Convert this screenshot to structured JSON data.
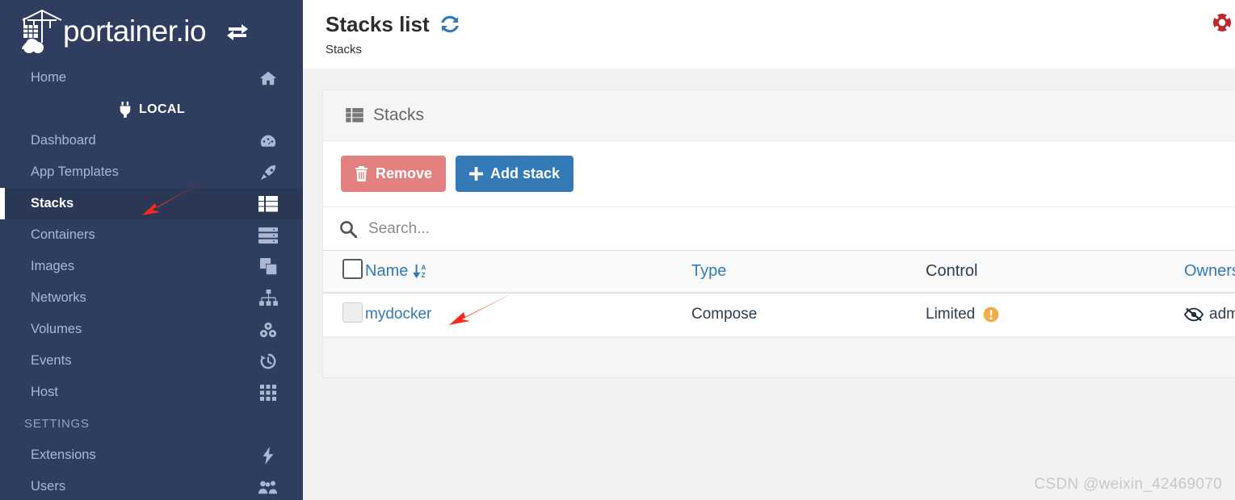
{
  "brand": {
    "name": "portainer.io",
    "logo_icon": "crane-container-cloud-icon",
    "swap_icon": "exchange-arrows-icon"
  },
  "sidebar": {
    "endpoint": {
      "label": "LOCAL",
      "icon": "plug-icon"
    },
    "items": [
      {
        "label": "Home",
        "icon": "home-icon",
        "active": false
      },
      {
        "label": "Dashboard",
        "icon": "tachometer-icon",
        "active": false
      },
      {
        "label": "App Templates",
        "icon": "rocket-icon",
        "active": false
      },
      {
        "label": "Stacks",
        "icon": "list-table-icon",
        "active": true
      },
      {
        "label": "Containers",
        "icon": "server-icon",
        "active": false
      },
      {
        "label": "Images",
        "icon": "clone-icon",
        "active": false
      },
      {
        "label": "Networks",
        "icon": "sitemap-icon",
        "active": false
      },
      {
        "label": "Volumes",
        "icon": "cubes-icon",
        "active": false
      },
      {
        "label": "Events",
        "icon": "history-icon",
        "active": false
      },
      {
        "label": "Host",
        "icon": "grid-icon",
        "active": false
      }
    ],
    "settings_section": {
      "label": "SETTINGS"
    },
    "settings_items": [
      {
        "label": "Extensions",
        "icon": "bolt-icon",
        "active": false
      },
      {
        "label": "Users",
        "icon": "users-icon",
        "active": false
      }
    ]
  },
  "header": {
    "title": "Stacks list",
    "refresh_icon": "refresh-sync-icon",
    "breadcrumb": "Stacks",
    "support_icon": "life-ring-icon"
  },
  "panel": {
    "title": "Stacks",
    "title_icon": "list-table-icon",
    "buttons": {
      "remove": {
        "label": "Remove",
        "icon": "trash-icon",
        "color": "#e38080"
      },
      "add": {
        "label": "Add stack",
        "icon": "plus-icon",
        "color": "#337ab7"
      }
    },
    "search": {
      "placeholder": "Search...",
      "value": "",
      "icon": "search-icon"
    },
    "table": {
      "columns": [
        {
          "key": "name",
          "label": "Name",
          "sortable": true,
          "sort_icon": "sort-alpha-down-icon"
        },
        {
          "key": "type",
          "label": "Type",
          "sortable": true
        },
        {
          "key": "control",
          "label": "Control",
          "sortable": false
        },
        {
          "key": "ownership",
          "label": "Ownership",
          "sortable": true
        }
      ],
      "rows": [
        {
          "name": "mydocker",
          "type": "Compose",
          "control": "Limited",
          "control_icon": "warning-circle-icon",
          "ownership": "administrators",
          "ownership_icon": "eye-slash-icon"
        }
      ]
    }
  },
  "annotations": {
    "arrow_stacks": "red-arrow-pointing-to-stacks",
    "arrow_mydocker": "red-arrow-pointing-to-mydocker"
  },
  "watermark": "CSDN @weixin_42469070",
  "colors": {
    "sidebar_bg": "#2f3e5e",
    "sidebar_active_bg": "#2a3856",
    "accent_blue": "#337ab7",
    "danger_red": "#e38080",
    "warning_orange": "#f0ad4e",
    "annotation_red": "#fa2a1e"
  }
}
